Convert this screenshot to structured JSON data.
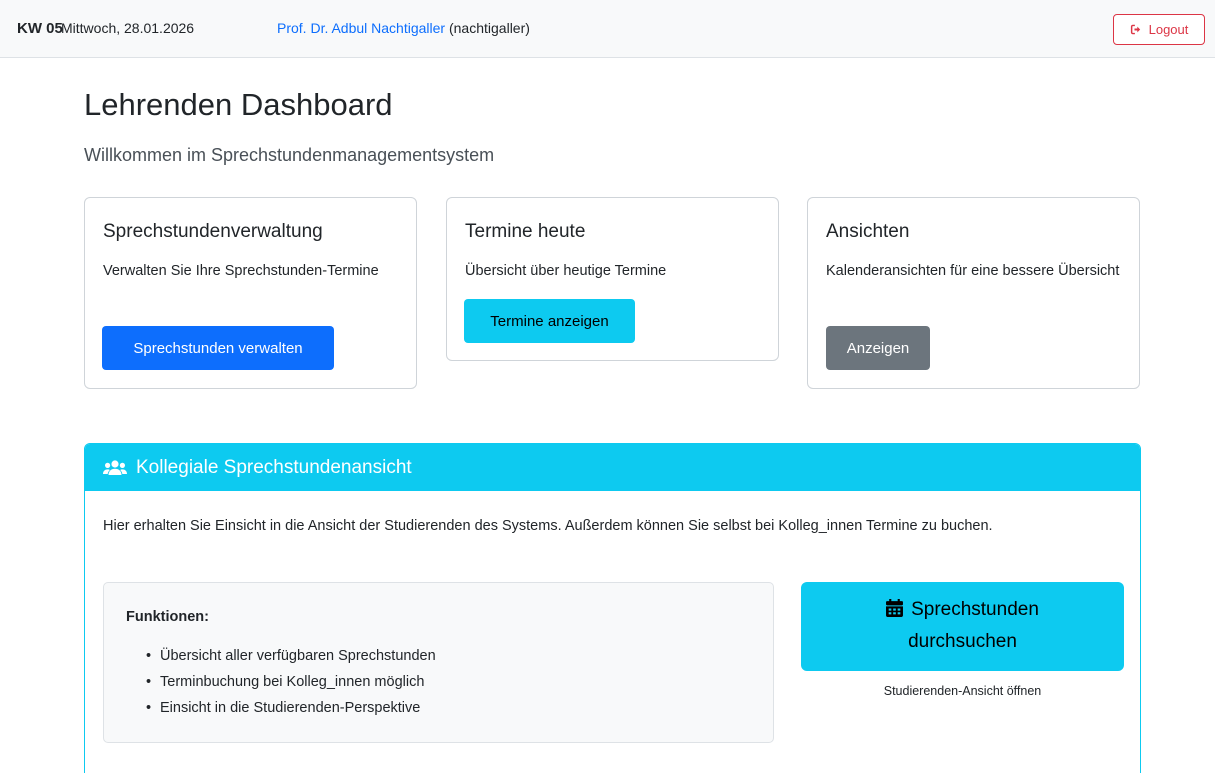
{
  "topbar": {
    "week": "KW 05",
    "date": "Mittwoch, 28.01.2026",
    "user_name": "Prof. Dr. Adbul Nachtigaller",
    "user_login": "(nachtigaller)",
    "logout_label": "Logout"
  },
  "page": {
    "title": "Lehrenden Dashboard",
    "subtitle": "Willkommen im Sprechstundenmanagementsystem"
  },
  "cards": [
    {
      "title": "Sprechstundenverwaltung",
      "text": "Verwalten Sie Ihre Sprechstunden-Termine",
      "button": "Sprechstunden verwalten"
    },
    {
      "title": "Termine heute",
      "text": "Übersicht über heutige Termine",
      "button": "Termine anzeigen"
    },
    {
      "title": "Ansichten",
      "text": "Kalenderansichten für eine bessere Übersicht",
      "button": "Anzeigen"
    }
  ],
  "colleague_panel": {
    "header": "Kollegiale Sprechstundenansicht",
    "description": "Hier erhalten Sie Einsicht in die Ansicht der Studierenden des Systems. Außerdem können Sie selbst bei Kolleg_innen Termine zu buchen.",
    "features_heading": "Funktionen:",
    "features": [
      "Übersicht aller verfügbaren Sprechstunden",
      "Terminbuchung bei Kolleg_innen möglich",
      "Einsicht in die Studierenden-Perspektive"
    ],
    "search_button_line1": "Sprechstunden",
    "search_button_line2": "durchsuchen",
    "open_hint": "Studierenden-Ansicht öffnen"
  },
  "colors": {
    "primary": "#0d6efd",
    "info": "#0dcaf0",
    "secondary": "#6c757d",
    "danger": "#dc3545"
  },
  "icons": [
    "sign-out-icon",
    "users-icon",
    "calendar-icon"
  ]
}
